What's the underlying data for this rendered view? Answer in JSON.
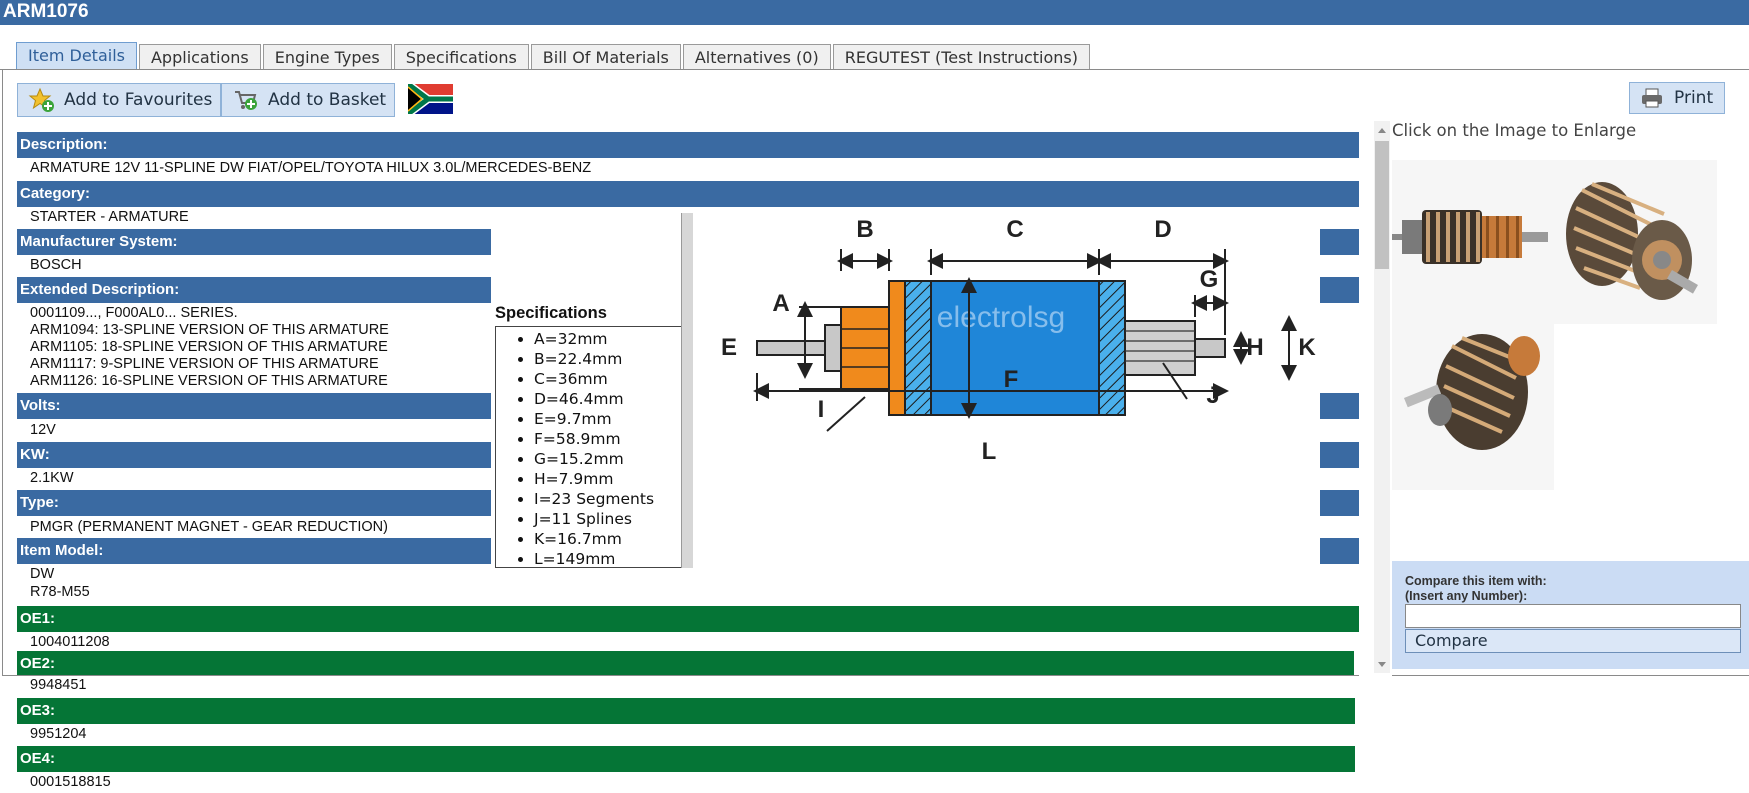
{
  "window": {
    "title": "ARM1076"
  },
  "tabs": [
    {
      "label": "Item Details",
      "active": true
    },
    {
      "label": "Applications"
    },
    {
      "label": "Engine Types"
    },
    {
      "label": "Specifications"
    },
    {
      "label": "Bill Of Materials"
    },
    {
      "label": "Alternatives (0)"
    },
    {
      "label": "REGUTEST (Test Instructions)"
    }
  ],
  "toolbar": {
    "favourites_label": "Add to Favourites",
    "basket_label": "Add to Basket",
    "print_label": "Print"
  },
  "details": {
    "description": {
      "label": "Description:",
      "value": "ARMATURE 12V 11-SPLINE DW FIAT/OPEL/TOYOTA HILUX 3.0L/MERCEDES-BENZ"
    },
    "category": {
      "label": "Category:",
      "value": "STARTER - ARMATURE"
    },
    "manufacturer": {
      "label": "Manufacturer System:",
      "value": "BOSCH"
    },
    "extended": {
      "label": "Extended Description:",
      "lines": [
        "0001109..., F000AL0... SERIES.",
        "ARM1094: 13-SPLINE VERSION OF THIS ARMATURE",
        "ARM1105: 18-SPLINE VERSION OF THIS ARMATURE",
        "ARM1117: 9-SPLINE VERSION OF THIS ARMATURE",
        "ARM1126: 16-SPLINE VERSION OF THIS ARMATURE"
      ]
    },
    "volts": {
      "label": "Volts:",
      "value": "12V"
    },
    "kw": {
      "label": "KW:",
      "value": "2.1KW"
    },
    "type": {
      "label": "Type:",
      "value": "PMGR (PERMANENT MAGNET - GEAR REDUCTION)"
    },
    "model": {
      "label": "Item Model:",
      "lines": [
        "DW",
        "R78-M55"
      ]
    },
    "oe1": {
      "label": "OE1:",
      "value": "1004011208"
    },
    "oe2": {
      "label": "OE2:",
      "value": "9948451"
    },
    "oe3": {
      "label": "OE3:",
      "value": "9951204"
    },
    "oe4": {
      "label": "OE4:",
      "value": "0001518815"
    }
  },
  "specifications": {
    "title": "Specifications",
    "items": [
      "A=32mm",
      "B=22.4mm",
      "C=36mm",
      "D=46.4mm",
      "E=9.7mm",
      "F=58.9mm",
      "G=15.2mm",
      "H=7.9mm",
      "I=23 Segments",
      "J=11 Splines",
      "K=16.7mm",
      "L=149mm"
    ]
  },
  "diagram": {
    "watermark": "electrolsg",
    "labels": {
      "a": "A",
      "b": "B",
      "c": "C",
      "d": "D",
      "e": "E",
      "f": "F",
      "g": "G",
      "h": "H",
      "i": "I",
      "j": "J",
      "k": "K",
      "l": "L"
    }
  },
  "images": {
    "enlarge_hint": "Click on the Image to Enlarge"
  },
  "compare": {
    "line1": "Compare this item with:",
    "line2": "(Insert any Number):",
    "button_label": "Compare"
  },
  "colors": {
    "header_blue": "#3a6aa2",
    "oe_green": "#057536",
    "orange": "#f08a1c",
    "core_blue": "#1f86d8"
  }
}
